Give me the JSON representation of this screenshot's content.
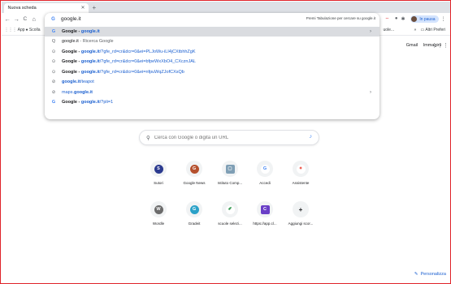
{
  "tab": {
    "title": "Nuova scheda",
    "new_tab": "+"
  },
  "nav": {
    "back": "←",
    "forward": "→",
    "reload": "C",
    "home": "⌂"
  },
  "omnibox": {
    "value": "google.it",
    "hint": "Premi Tabulazione per cercare su google.it",
    "suggestions": [
      {
        "prefix": "Google - ",
        "bold": "google.it",
        "rest": "",
        "icon": "G"
      },
      {
        "prefix": "google.it",
        "bold": "",
        "rest": " - Ricerca Google",
        "icon": "Q"
      },
      {
        "prefix": "Google - ",
        "bold": "google.it",
        "rest": "/?gfe_rd=cr&dcr=0&ei=PLJoWu-iLI4jCXtbhhZgK",
        "icon": "⊙"
      },
      {
        "prefix": "Google - ",
        "bold": "google.it",
        "rest": "/?gfe_rd=cr&dcr=0&ei=bfpeWxXbO4_CXcznJAL",
        "icon": "⊙"
      },
      {
        "prefix": "Google - ",
        "bold": "google.it",
        "rest": "/?gfe_rd=cr&dcr=0&ei=nfpuWqZJofCXsQb",
        "icon": "⊙"
      },
      {
        "prefix": "",
        "bold": "google.it",
        "rest": "/teapot",
        "icon": "⊘"
      },
      {
        "prefix": "maps.",
        "bold": "google.it",
        "rest": "",
        "icon": "⊘"
      },
      {
        "prefix": "Google - ",
        "bold": "google.it",
        "rest": "/?pli=1",
        "icon": "G"
      }
    ]
  },
  "profile": {
    "label": "In pausa"
  },
  "bookmarks": {
    "apps": "App",
    "first": "Scolla",
    "uole": "uole...",
    "other": "Altri Preferi"
  },
  "google_top": {
    "gmail": "Gmail",
    "images": "Immagini"
  },
  "search": {
    "placeholder": "Cerca con Google o digita un URL"
  },
  "shortcuts": [
    {
      "label": "Sutori",
      "letter": "S",
      "color": "#2b3a8f"
    },
    {
      "label": "Google News",
      "letter": "G",
      "color": "#b5502d"
    },
    {
      "label": "Istituto Comp...",
      "letter": "▢",
      "color": "#7f9fb5"
    },
    {
      "label": "Accedi",
      "letter": "G",
      "color": "#ffffff"
    },
    {
      "label": "Assistente",
      "letter": "✦",
      "color": "#ffffff"
    },
    {
      "label": "Wordle",
      "letter": "W",
      "color": "#6b6b6b"
    },
    {
      "label": "Gradeit",
      "letter": "G",
      "color": "#2aa1c8"
    },
    {
      "label": "scuole selezi...",
      "letter": "✐",
      "color": "#ffffff"
    },
    {
      "label": "https://app.cl...",
      "letter": "C",
      "color": "#6a3fc7"
    },
    {
      "label": "Aggiungi scor...",
      "letter": "+",
      "color": "#f1f3f4"
    }
  ],
  "customize": {
    "label": "Personalizza"
  }
}
